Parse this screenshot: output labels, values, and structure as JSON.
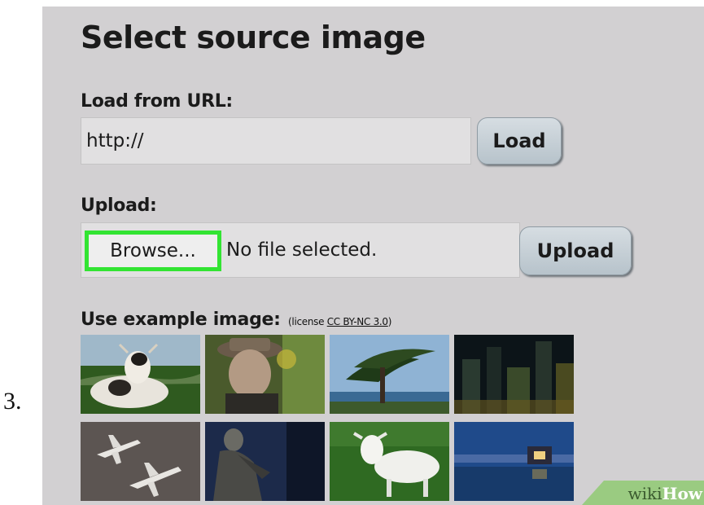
{
  "step": {
    "number": "3."
  },
  "panel": {
    "title": "Select source image",
    "url_section": {
      "label": "Load from URL:",
      "value": "http://",
      "load_button": "Load"
    },
    "upload_section": {
      "label": "Upload:",
      "browse_button": "Browse...",
      "file_status": "No file selected.",
      "upload_button": "Upload",
      "highlight_color": "#32e432"
    },
    "examples": {
      "label": "Use example image:",
      "license_prefix": "(license",
      "license_link": "CC BY-NC 3.0",
      "license_suffix": ")",
      "images": [
        {
          "name": "cow-in-field"
        },
        {
          "name": "old-man-portrait"
        },
        {
          "name": "tree-on-coast"
        },
        {
          "name": "city-at-night"
        },
        {
          "name": "airplanes-on-tarmac"
        },
        {
          "name": "statue-against-sky"
        },
        {
          "name": "goat-on-grass"
        },
        {
          "name": "lake-at-dusk"
        }
      ]
    }
  },
  "watermark": {
    "wiki": "wiki",
    "how": "How"
  }
}
